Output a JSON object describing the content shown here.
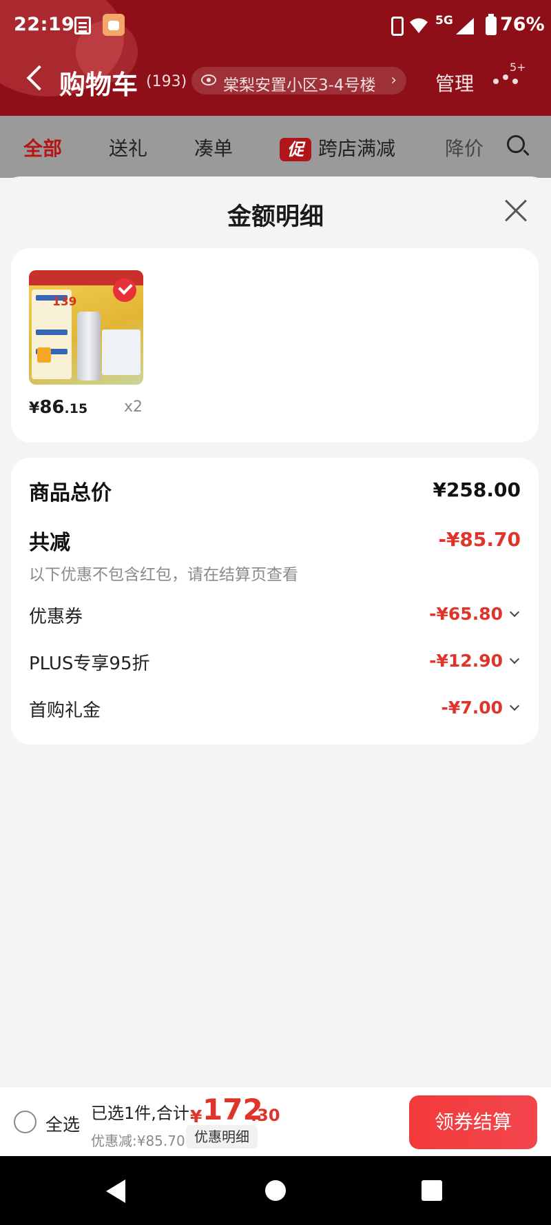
{
  "status_bar": {
    "time": "22:19",
    "network": "5G",
    "battery": "76%"
  },
  "header": {
    "title": "购物车",
    "count": "(193)",
    "address": "棠梨安置小区3-4号楼",
    "manage": "管理",
    "badge": "5+"
  },
  "tabs": [
    {
      "label": "全部",
      "active": true
    },
    {
      "label": "送礼"
    },
    {
      "label": "凑单"
    },
    {
      "label": "跨店满减",
      "promo": "促"
    },
    {
      "label": "降价"
    }
  ],
  "sheet": {
    "title": "金额明细",
    "item": {
      "price_symbol": "¥",
      "price_int": "86",
      "price_dec": ".15",
      "quantity": "x2",
      "thumb_price": "139"
    },
    "summary": {
      "total_label": "商品总价",
      "total_value": "¥258.00",
      "discount_label": "共减",
      "discount_value": "-¥85.70",
      "note": "以下优惠不包含红包，请在结算页查看",
      "lines": [
        {
          "label": "优惠券",
          "value": "-¥65.80"
        },
        {
          "label": "PLUS专享95折",
          "value": "-¥12.90"
        },
        {
          "label": "首购礼金",
          "value": "-¥7.00"
        }
      ]
    }
  },
  "bottom_bar": {
    "select_all": "全选",
    "selected_info": "已选1件,合计:",
    "total_symbol": "¥",
    "total_int": "172",
    "total_dec": ".30",
    "discount_text": "优惠减:¥85.70",
    "detail_button": "优惠明细",
    "checkout_button": "领券结算"
  },
  "colors": {
    "header_bg": "#8e0f17",
    "accent_red": "#e0342a",
    "checkout": "#f33a3a"
  }
}
